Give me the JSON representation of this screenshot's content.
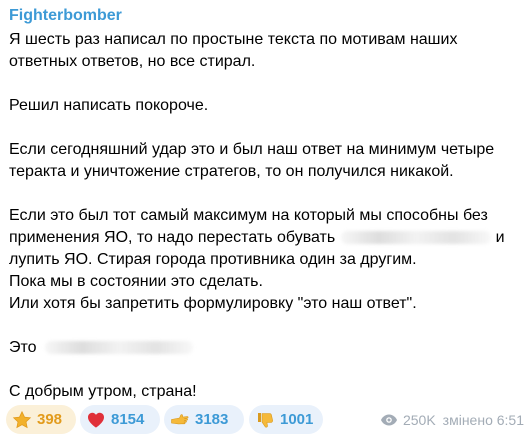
{
  "post": {
    "author": "Fighterbomber",
    "paragraphs": [
      {
        "lines": [
          "Я шесть раз написал по простыне текста по мотивам наших",
          "ответных ответов, но все стирал."
        ]
      },
      {
        "lines": [
          "Решил написать покороче."
        ]
      },
      {
        "lines": [
          "Если сегодняшний удар это и был наш ответ на минимум четыре",
          "теракта и уничтожение стратегов, то он получился никакой."
        ]
      },
      {
        "lines": [
          "Если это был тот самый максимум на который мы способны без",
          "применения ЯО, то надо перестать обувать",
          "и",
          "лупить ЯО. Стирая города противника один за другим.",
          "Пока мы в состоянии это сделать.",
          "Или хотя бы запретить формулировку \"это наш ответ\"."
        ]
      },
      {
        "lines": [
          "Это"
        ]
      },
      {
        "lines": [
          "С добрым утром, страна!"
        ]
      }
    ],
    "reactions": [
      {
        "icon": "star-icon",
        "count": "398",
        "color": "#e29b1c"
      },
      {
        "icon": "heart-icon",
        "count": "8154",
        "color": "#e0303a"
      },
      {
        "icon": "hand-icon",
        "count": "3183",
        "color": "#f5b93a"
      },
      {
        "icon": "thumbs-down-icon",
        "count": "1001",
        "color": "#f5b93a"
      }
    ],
    "views": "250K",
    "edited_time": "змінено 6:51",
    "link_color": "#3d9ad6"
  }
}
